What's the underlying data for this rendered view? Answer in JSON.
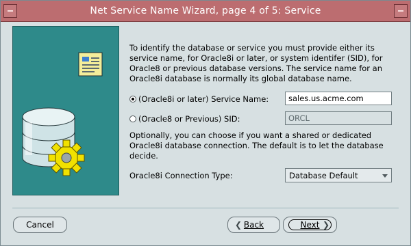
{
  "window": {
    "title": "Net Service Name Wizard, page 4 of 5: Service"
  },
  "description": "To identify the database or service you must provide either its service name, for Oracle8i or later, or system identifer (SID), for Oracle8 or previous database versions. The service name for an Oracle8i database is normally its global database name.",
  "service_name_option": {
    "label": "(Oracle8i or later)  Service Name:",
    "value": "sales.us.acme.com",
    "selected": true
  },
  "sid_option": {
    "label": "(Oracle8 or Previous) SID:",
    "value": "ORCL",
    "selected": false
  },
  "connection_description": "Optionally, you can choose if you want a shared or dedicated Oracle8i database connection. The default is to let the database decide.",
  "connection_type": {
    "label": "Oracle8i Connection Type:",
    "selected": "Database Default"
  },
  "buttons": {
    "cancel": "Cancel",
    "back": "Back",
    "next": "Next"
  },
  "icons": [
    "window-menu-icon",
    "minimize-icon",
    "database-icon",
    "gear-icon",
    "document-icon"
  ]
}
